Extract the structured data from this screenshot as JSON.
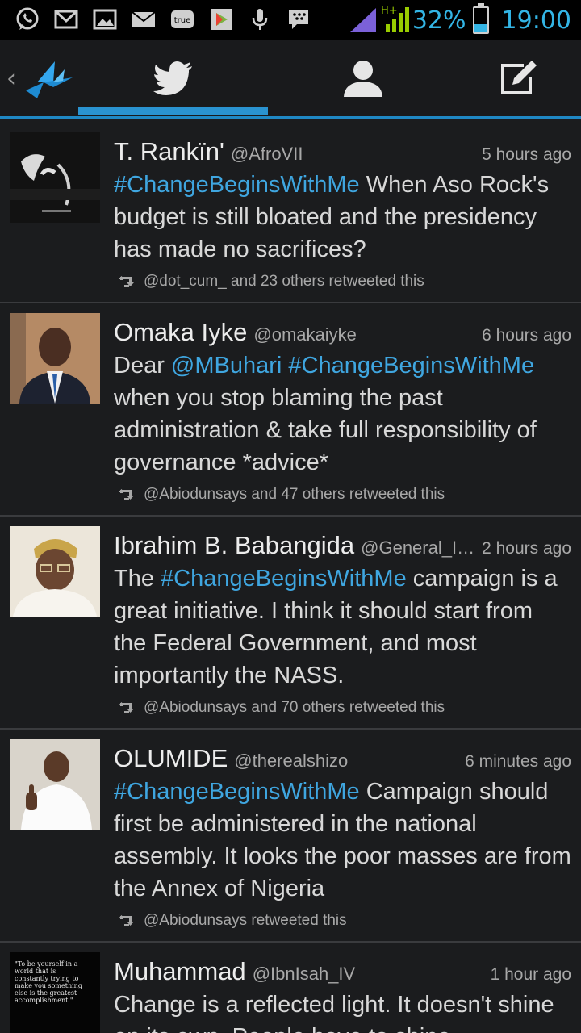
{
  "status_bar": {
    "battery_percent": "32%",
    "time": "19:00",
    "network_type": "H+",
    "notification_icons": [
      "whatsapp-icon",
      "gmail-icon",
      "gallery-icon",
      "email-icon",
      "truecaller-icon",
      "playstore-icon",
      "microphone-icon",
      "bbm-icon"
    ],
    "accent_color": "#33b5e5",
    "battery_level": 0.32
  },
  "action_bar": {
    "back_glyph": "‹",
    "tabs": [
      {
        "name": "timeline",
        "icon": "twitter-bird-icon",
        "active": true
      },
      {
        "name": "profile",
        "icon": "person-icon",
        "active": false
      },
      {
        "name": "compose",
        "icon": "compose-icon",
        "active": false
      }
    ],
    "active_color": "#2a93d0"
  },
  "tweets": [
    {
      "name": "T. Rankïn'",
      "handle": "@AfroVII",
      "time": "5 hours ago",
      "body_parts": [
        {
          "text": "#ChangeBeginsWithMe",
          "link": true
        },
        {
          "text": " When Aso Rock's budget is still bloated and the presidency has made no sacrifices?",
          "link": false
        }
      ],
      "retweet": "@dot_cum_ and 23 others retweeted this",
      "avatar_icon": "album-cover-avatar"
    },
    {
      "name": "Omaka Iyke",
      "handle": "@omakaiyke",
      "time": "6 hours ago",
      "body_parts": [
        {
          "text": "Dear ",
          "link": false
        },
        {
          "text": "@MBuhari",
          "link": true
        },
        {
          "text": " ",
          "link": false
        },
        {
          "text": "#ChangeBeginsWithMe",
          "link": true
        },
        {
          "text": " when you stop blaming the past administration & take full responsibility of governance *advice*",
          "link": false
        }
      ],
      "retweet": "@Abiodunsays and 47 others retweeted this",
      "avatar_icon": "man-in-suit-avatar"
    },
    {
      "name": "Ibrahim B. Babangida",
      "handle": "@General_Ibb...",
      "time": "2 hours ago",
      "body_parts": [
        {
          "text": "The ",
          "link": false
        },
        {
          "text": "#ChangeBeginsWithMe",
          "link": true
        },
        {
          "text": " campaign is a great initiative. I think it should start from the Federal Government, and most importantly the NASS.",
          "link": false
        }
      ],
      "retweet": "@Abiodunsays and 70 others retweeted this",
      "avatar_icon": "man-in-cap-avatar"
    },
    {
      "name": "OLUMIDE",
      "handle": "@therealshizo",
      "time": "6 minutes ago",
      "body_parts": [
        {
          "text": "#ChangeBeginsWithMe",
          "link": true
        },
        {
          "text": " Campaign should first be administered in the national assembly. It looks the poor masses are from the Annex of Nigeria",
          "link": false
        }
      ],
      "retweet": "@Abiodunsays retweeted this",
      "avatar_icon": "thumbs-up-man-avatar"
    },
    {
      "name": "Muhammad",
      "handle": "@IbnIsah_IV",
      "time": "1 hour ago",
      "body_parts": [
        {
          "text": "Change is a reflected light. It doesn't shine on its own. People have to shine",
          "link": false
        }
      ],
      "retweet": "",
      "avatar_icon": "quote-text-avatar",
      "avatar_quote": "\"To be yourself in a world that is constantly trying to make you something else is the greatest accomplishment.\""
    }
  ]
}
